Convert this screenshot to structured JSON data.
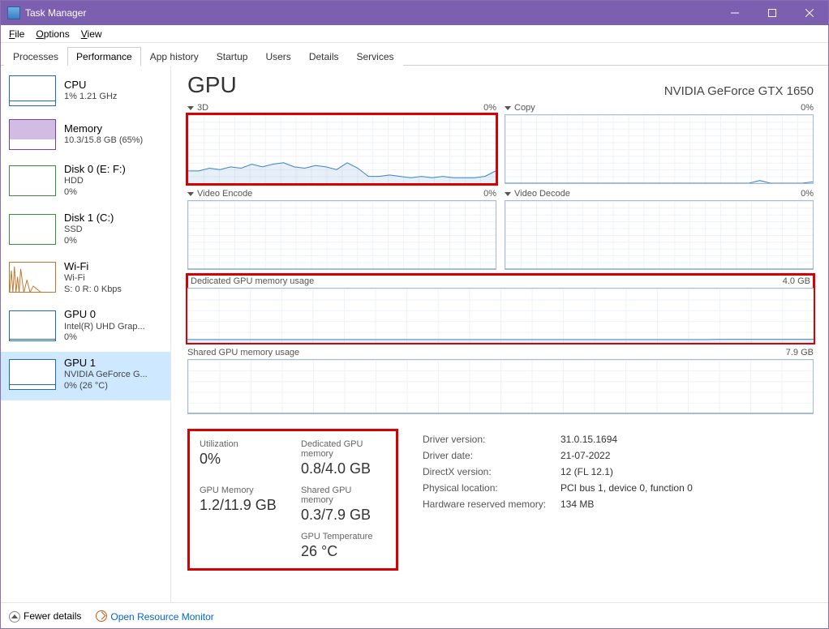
{
  "window": {
    "title": "Task Manager"
  },
  "menubar": [
    "File",
    "Options",
    "View"
  ],
  "tabs": [
    "Processes",
    "Performance",
    "App history",
    "Startup",
    "Users",
    "Details",
    "Services"
  ],
  "active_tab": "Performance",
  "sidebar": {
    "items": [
      {
        "name": "CPU",
        "sub1": "1% 1.21 GHz",
        "sub2": ""
      },
      {
        "name": "Memory",
        "sub1": "10.3/15.8 GB (65%)",
        "sub2": ""
      },
      {
        "name": "Disk 0 (E: F:)",
        "sub1": "HDD",
        "sub2": "0%"
      },
      {
        "name": "Disk 1 (C:)",
        "sub1": "SSD",
        "sub2": "0%"
      },
      {
        "name": "Wi-Fi",
        "sub1": "Wi-Fi",
        "sub2": "S: 0 R: 0 Kbps"
      },
      {
        "name": "GPU 0",
        "sub1": "Intel(R) UHD Grap...",
        "sub2": "0%"
      },
      {
        "name": "GPU 1",
        "sub1": "NVIDIA GeForce G...",
        "sub2": "0% (26 °C)"
      }
    ],
    "selected_index": 6
  },
  "main": {
    "title": "GPU",
    "device": "NVIDIA GeForce GTX 1650",
    "engine_charts": [
      {
        "label": "3D",
        "value": "0%"
      },
      {
        "label": "Copy",
        "value": "0%"
      },
      {
        "label": "Video Encode",
        "value": "0%"
      },
      {
        "label": "Video Decode",
        "value": "0%"
      }
    ],
    "mem_charts": [
      {
        "label": "Dedicated GPU memory usage",
        "max": "4.0 GB"
      },
      {
        "label": "Shared GPU memory usage",
        "max": "7.9 GB"
      }
    ],
    "stats": {
      "utilization_label": "Utilization",
      "utilization": "0%",
      "dedicated_label": "Dedicated GPU memory",
      "dedicated": "0.8/4.0 GB",
      "gpumem_label": "GPU Memory",
      "gpumem": "1.2/11.9 GB",
      "shared_label": "Shared GPU memory",
      "shared": "0.3/7.9 GB",
      "temp_label": "GPU Temperature",
      "temp": "26 °C"
    },
    "info": [
      {
        "k": "Driver version:",
        "v": "31.0.15.1694"
      },
      {
        "k": "Driver date:",
        "v": "21-07-2022"
      },
      {
        "k": "DirectX version:",
        "v": "12 (FL 12.1)"
      },
      {
        "k": "Physical location:",
        "v": "PCI bus 1, device 0, function 0"
      },
      {
        "k": "Hardware reserved memory:",
        "v": "134 MB"
      }
    ]
  },
  "footer": {
    "fewer": "Fewer details",
    "resmon": "Open Resource Monitor"
  },
  "chart_data": [
    {
      "type": "line",
      "title": "3D",
      "ylim": [
        0,
        100
      ],
      "values": [
        18,
        18,
        22,
        20,
        24,
        22,
        28,
        24,
        28,
        30,
        24,
        22,
        26,
        24,
        20,
        30,
        22,
        10,
        10,
        12,
        10,
        8,
        10,
        8,
        10,
        8,
        8,
        8,
        10,
        18
      ]
    },
    {
      "type": "line",
      "title": "Copy",
      "ylim": [
        0,
        100
      ],
      "values": [
        0,
        0,
        0,
        0,
        0,
        0,
        0,
        0,
        0,
        0,
        0,
        0,
        0,
        0,
        0,
        0,
        0,
        0,
        0,
        0,
        0,
        0,
        0,
        0,
        4,
        0,
        0,
        0,
        0,
        2
      ]
    },
    {
      "type": "line",
      "title": "Video Encode",
      "ylim": [
        0,
        100
      ],
      "values": [
        0,
        0,
        0,
        0,
        0,
        0,
        0,
        0,
        0,
        0,
        0,
        0,
        0,
        0,
        0,
        0,
        0,
        0,
        0,
        0,
        0,
        0,
        0,
        0,
        0,
        0,
        0,
        0,
        0,
        0
      ]
    },
    {
      "type": "line",
      "title": "Video Decode",
      "ylim": [
        0,
        100
      ],
      "values": [
        0,
        0,
        0,
        0,
        0,
        0,
        0,
        0,
        0,
        0,
        0,
        0,
        0,
        0,
        0,
        0,
        0,
        0,
        0,
        0,
        0,
        0,
        0,
        0,
        0,
        0,
        0,
        0,
        0,
        0
      ]
    },
    {
      "type": "line",
      "title": "Dedicated GPU memory usage",
      "ylim": [
        0,
        4.0
      ],
      "unit": "GB",
      "values": [
        0.25,
        0.25,
        0.25,
        0.25,
        0.25,
        0.25,
        0.25,
        0.25,
        0.25,
        0.25,
        0.25,
        0.25,
        0.25,
        0.25,
        0.25,
        0.25,
        0.25,
        0.25,
        0.25,
        0.25,
        0.25,
        0.25,
        0.25,
        0.25,
        0.25,
        0.26,
        0.26,
        0.26,
        0.26,
        0.26
      ]
    },
    {
      "type": "line",
      "title": "Shared GPU memory usage",
      "ylim": [
        0,
        7.9
      ],
      "unit": "GB",
      "values": [
        0,
        0,
        0,
        0,
        0,
        0,
        0,
        0,
        0,
        0,
        0,
        0,
        0,
        0,
        0,
        0,
        0,
        0,
        0,
        0,
        0,
        0,
        0,
        0,
        0,
        0,
        0,
        0,
        0,
        0
      ]
    }
  ]
}
